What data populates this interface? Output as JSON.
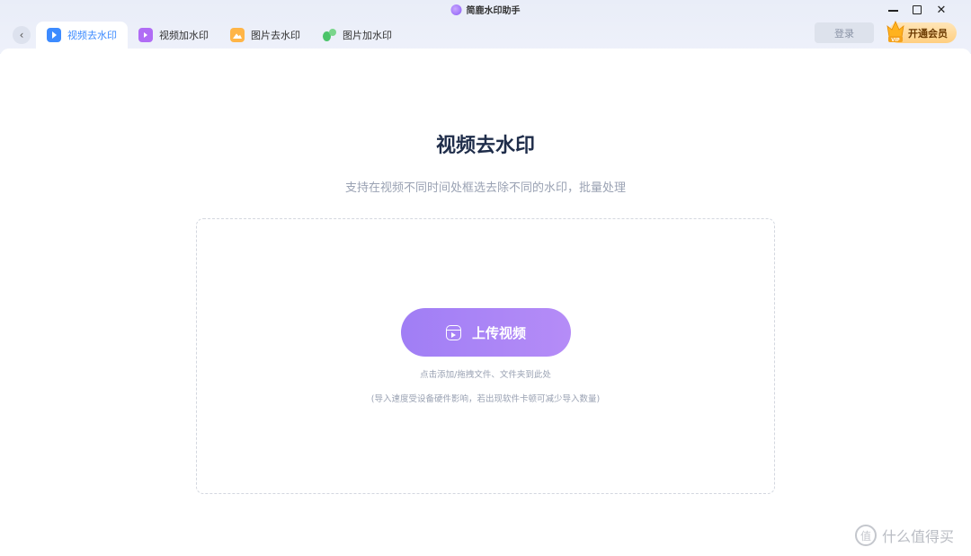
{
  "window": {
    "title": "简鹿水印助手",
    "controls": {
      "minimize": "minimize",
      "maximize": "maximize",
      "close": "✕"
    }
  },
  "nav": {
    "back_icon": "chevron-left-icon",
    "tabs": [
      {
        "label": "视频去水印",
        "icon": "video-remove-icon",
        "active": true
      },
      {
        "label": "视频加水印",
        "icon": "video-add-icon",
        "active": false
      },
      {
        "label": "图片去水印",
        "icon": "image-remove-icon",
        "active": false
      },
      {
        "label": "图片加水印",
        "icon": "image-add-icon",
        "active": false
      }
    ],
    "login_label": "登录",
    "vip_label": "开通会员",
    "vip_badge": "VIP"
  },
  "main": {
    "title": "视频去水印",
    "subtitle": "支持在视频不同时间处框选去除不同的水印，批量处理",
    "upload_label": "上传视频",
    "hint": "点击添加/拖拽文件、文件夹到此处",
    "note": "(导入速度受设备硬件影响，若出现软件卡顿可减少导入数量)"
  },
  "watermark": {
    "text": "什么值得买",
    "logo": "值"
  },
  "colors": {
    "accent": "#3d8bff",
    "upload_button": "#a67ff5",
    "title": "#1f2d4a",
    "muted": "#9aa2b3"
  }
}
